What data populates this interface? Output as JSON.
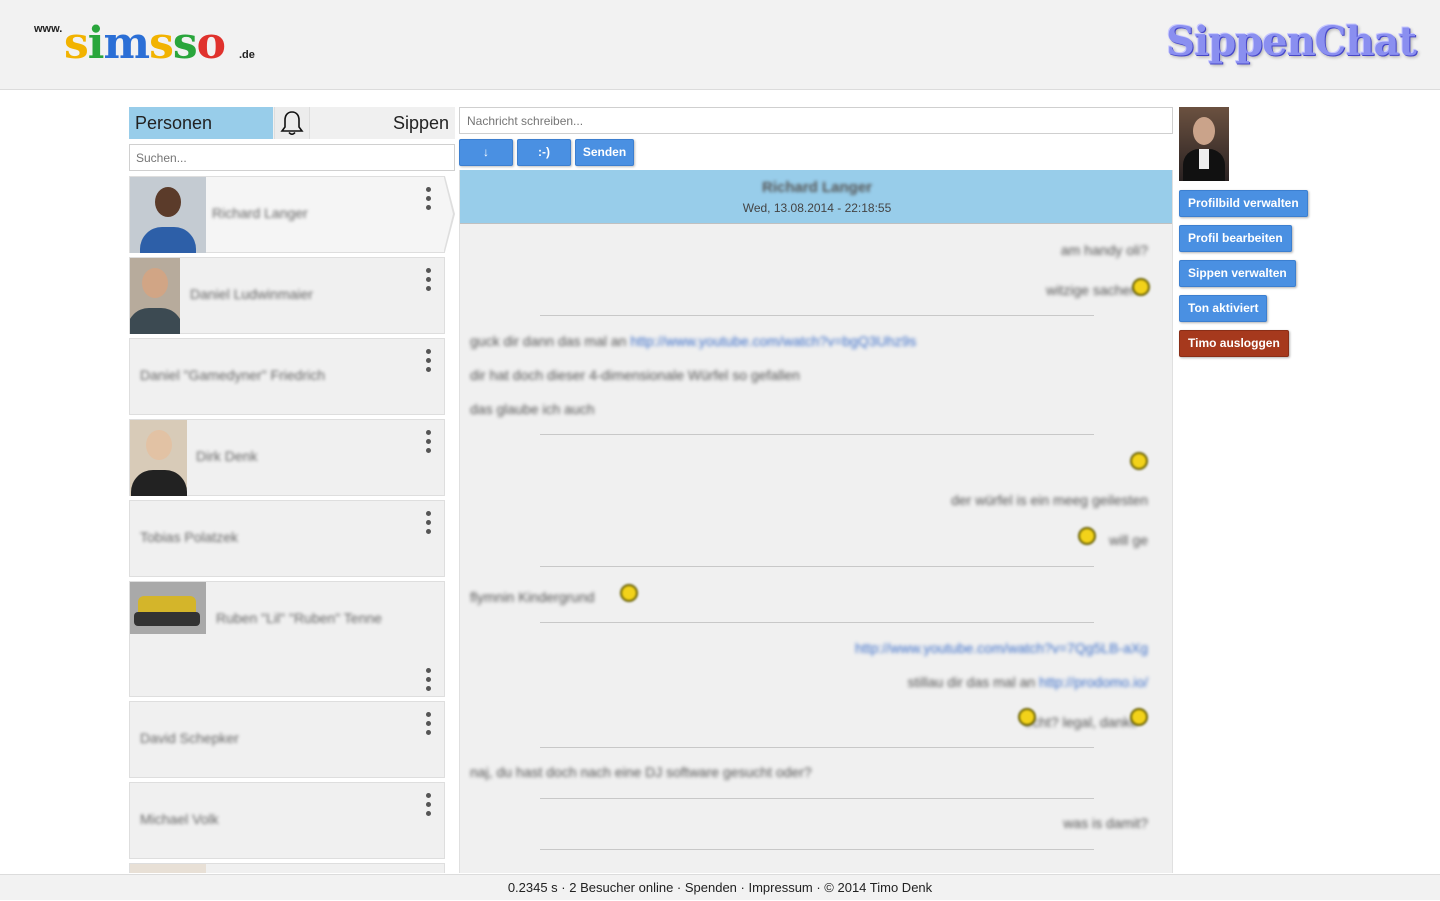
{
  "header": {
    "logo_prefix": "www.",
    "logo_letters": [
      "s",
      "i",
      "m",
      "s",
      "s",
      "o"
    ],
    "logo_suffix": ".de",
    "brand": "SippenChat"
  },
  "tabs": {
    "personen": "Personen",
    "bell_icon": "bell-icon",
    "sippen": "Sippen"
  },
  "search": {
    "placeholder": "Suchen..."
  },
  "people": [
    {
      "name": "Richard Langer",
      "has_photo": true
    },
    {
      "name": "Daniel Ludwinmaier",
      "has_photo": true
    },
    {
      "name": "Daniel \"Gamedyner\" Friedrich",
      "has_photo": false
    },
    {
      "name": "Dirk Denk",
      "has_photo": true
    },
    {
      "name": "Tobias Polatzek",
      "has_photo": false
    },
    {
      "name": "Ruben \"Lil\" \"Ruben\" Tenne",
      "has_photo": true
    },
    {
      "name": "David Schepker",
      "has_photo": false
    },
    {
      "name": "Michael Volk",
      "has_photo": false
    }
  ],
  "compose": {
    "placeholder": "Nachricht schreiben...",
    "down_label": "↓",
    "smiley_label": ":-)",
    "send_label": "Senden"
  },
  "chat": {
    "partner": "Richard Langer",
    "timestamp": "Wed, 13.08.2014 - 22:18:55",
    "messages": [
      {
        "side": "r",
        "text": "am handy oli?"
      },
      {
        "side": "r",
        "text": "witzige sachen"
      },
      {
        "side": "l",
        "text": "guck dir dann das mal an ",
        "link": "http://www.youtube.com/watch?v=bgQ3Uhz9s"
      },
      {
        "side": "l",
        "text": "dir hat doch dieser 4-dimensionale Würfel so gefallen"
      },
      {
        "side": "l",
        "text": "das glaube ich auch"
      },
      {
        "side": "r",
        "text": "der würfel is ein meeg geilesten"
      },
      {
        "side": "r",
        "text": "will ge"
      },
      {
        "side": "l",
        "text": "flymnin Kindergrund"
      },
      {
        "side": "r",
        "text": "",
        "link": "http://www.youtube.com/watch?v=7Qg5LB-aXg"
      },
      {
        "side": "r",
        "text": "stillau dir das mal an ",
        "link": "http://prodomo.io/"
      },
      {
        "side": "r",
        "text": "echt? legal, danke"
      },
      {
        "side": "l",
        "text": "naj, du hast doch nach eine DJ software gesucht oder?"
      },
      {
        "side": "r",
        "text": "was is damit?"
      }
    ]
  },
  "side": {
    "profile_photo": "profile-photo",
    "buttons": {
      "profilbild": "Profilbild verwalten",
      "profil": "Profil bearbeiten",
      "sippen": "Sippen verwalten",
      "ton": "Ton aktiviert",
      "logout": "Timo ausloggen"
    },
    "logout_color": "#a6391d",
    "accent_color": "#4a90e2"
  },
  "footer": {
    "text": "0.2345 s · 2 Besucher online · Spenden · Impressum · © 2014 Timo Denk"
  }
}
